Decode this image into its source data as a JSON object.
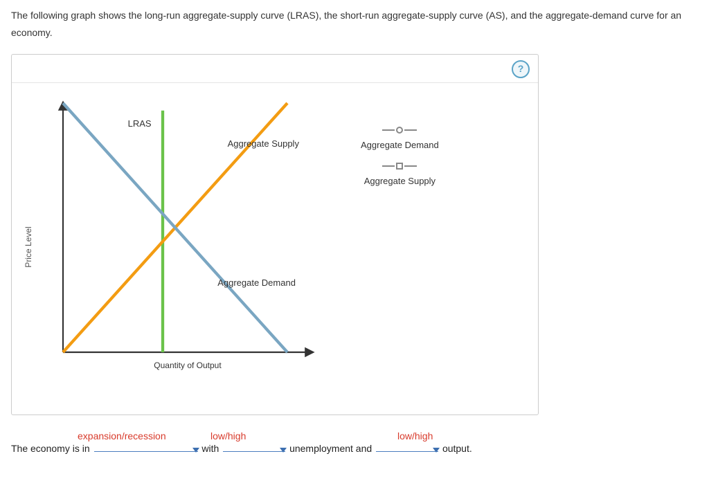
{
  "intro": "The following graph shows the long-run aggregate-supply curve (LRAS), the short-run aggregate-supply curve (AS), and the aggregate-demand curve for an economy.",
  "help_label": "?",
  "chart": {
    "ylabel": "Price Level",
    "xlabel": "Quantity of Output",
    "curve_lras_label": "LRAS",
    "curve_as_label": "Aggregate Supply",
    "curve_ad_label": "Aggregate Demand"
  },
  "legend": {
    "ad": "Aggregate Demand",
    "as": "Aggregate Supply"
  },
  "sentence": {
    "prefix": "The economy is in ",
    "mid1": " with ",
    "mid2": " unemployment and ",
    "suffix": " output."
  },
  "hints": {
    "blank1": "expansion/recession",
    "blank2": "low/high",
    "blank3": "low/high"
  },
  "chart_data": {
    "type": "line",
    "title": "",
    "xlabel": "Quantity of Output",
    "ylabel": "Price Level",
    "xlim": [
      0,
      100
    ],
    "ylim": [
      0,
      100
    ],
    "series": [
      {
        "name": "LRAS",
        "x": [
          40,
          40
        ],
        "y": [
          0,
          100
        ],
        "color": "#6ac24a"
      },
      {
        "name": "Aggregate Supply",
        "x": [
          0,
          90
        ],
        "y": [
          0,
          100
        ],
        "color": "#f39c12"
      },
      {
        "name": "Aggregate Demand",
        "x": [
          0,
          90
        ],
        "y": [
          100,
          0
        ],
        "color": "#7aa6c2"
      }
    ],
    "intersections": {
      "AD_AS": {
        "x": 45,
        "y": 50
      },
      "AD_LRAS": {
        "x": 40,
        "y": 56
      },
      "AS_LRAS": {
        "x": 40,
        "y": 44
      }
    },
    "legend_position": "right",
    "grid": false
  }
}
